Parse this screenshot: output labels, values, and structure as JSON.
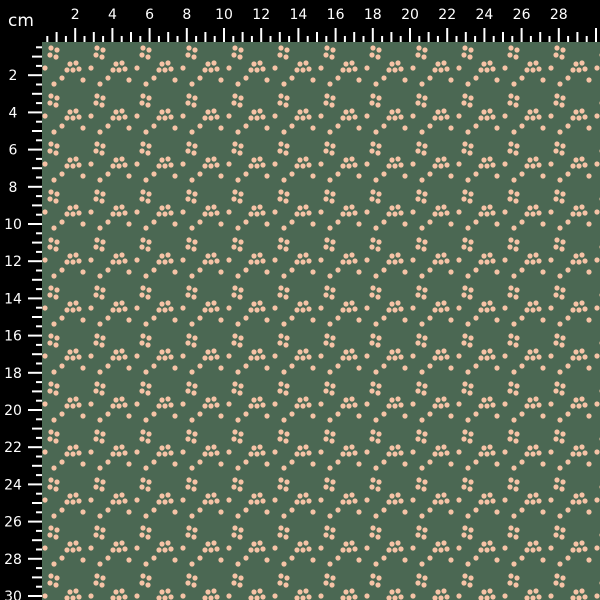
{
  "ruler": {
    "unit_label": "cm",
    "top_labels": [
      "2",
      "4",
      "6",
      "8",
      "10",
      "12",
      "14",
      "16",
      "18",
      "20",
      "22",
      "24",
      "26",
      "28"
    ],
    "left_labels": [
      "2",
      "4",
      "6",
      "8",
      "10",
      "12",
      "14",
      "16",
      "18",
      "20",
      "22",
      "24",
      "26",
      "28",
      "30"
    ]
  },
  "colors": {
    "ruler_bg": "#000000",
    "ruler_fg": "#ffffff",
    "fabric_bg": "#4b6853",
    "dot": "#f6c3a6"
  },
  "fabric": {
    "pattern": "polka dot triad / scattered small dots",
    "motif_icon": "dot-cluster-icon"
  }
}
